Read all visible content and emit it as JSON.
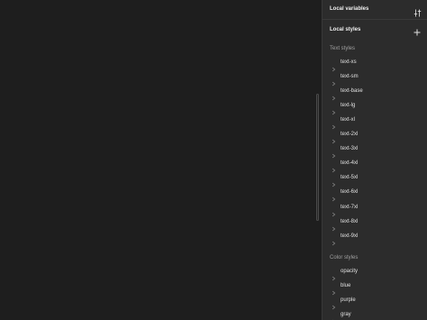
{
  "panel": {
    "title": "Local variables",
    "header_icon": "adjust-sliders-icon",
    "local_styles_label": "Local styles",
    "add_icon": "plus-icon"
  },
  "text_styles": {
    "title": "Text styles",
    "items": [
      {
        "label": "text-xs"
      },
      {
        "label": "text-sm"
      },
      {
        "label": "text-base"
      },
      {
        "label": "text-lg"
      },
      {
        "label": "text-xl"
      },
      {
        "label": "text-2xl"
      },
      {
        "label": "text-3xl"
      },
      {
        "label": "text-4xl"
      },
      {
        "label": "text-5xl"
      },
      {
        "label": "text-6xl"
      },
      {
        "label": "text-7xl"
      },
      {
        "label": "text-8xl"
      },
      {
        "label": "text-9xl"
      }
    ]
  },
  "color_styles": {
    "title": "Color styles",
    "items": [
      {
        "label": "opacity"
      },
      {
        "label": "blue"
      },
      {
        "label": "purple"
      },
      {
        "label": "gray"
      }
    ]
  },
  "colors": {
    "canvas": "#1e1e1e",
    "panel": "#2c2c2c",
    "text": "#e0e0e0",
    "muted": "#a0a0a0"
  }
}
